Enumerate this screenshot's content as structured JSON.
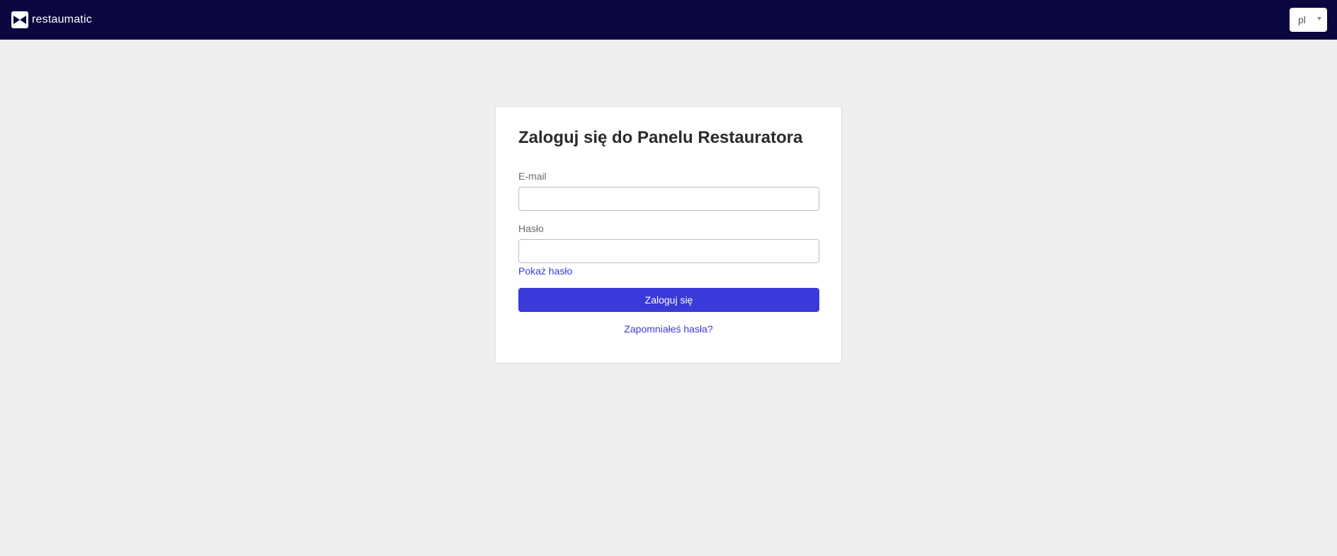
{
  "header": {
    "brand_name": "restaumatic",
    "brand_icon": "bow-tie-logo-icon",
    "language": "pl",
    "colors": {
      "background": "#0b0840"
    }
  },
  "login": {
    "title": "Zaloguj się do Panelu Restauratora",
    "email_label": "E-mail",
    "email_value": "",
    "password_label": "Hasło",
    "password_value": "",
    "show_password_label": "Pokaż hasło",
    "submit_label": "Zaloguj się",
    "forgot_password_label": "Zapomniałeś hasła?",
    "colors": {
      "accent": "#3a39d9",
      "page_background": "#eeeeee"
    }
  }
}
